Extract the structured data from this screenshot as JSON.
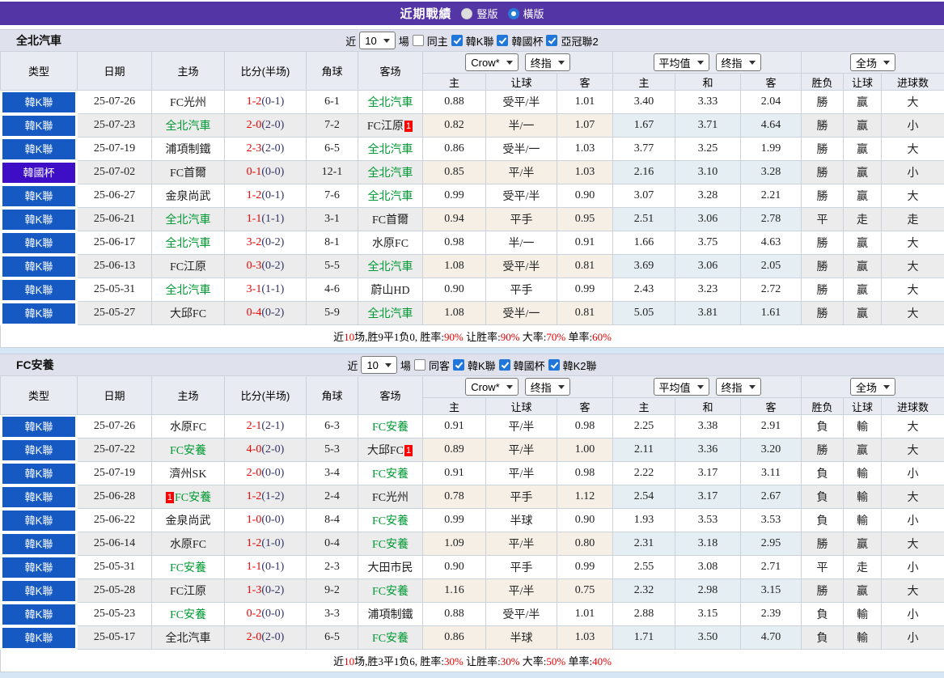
{
  "title_bar": {
    "title": "近期戰績",
    "radio_vertical": "豎版",
    "radio_horizontal": "橫版",
    "selected": "橫版"
  },
  "common": {
    "near_label": "近",
    "count_value": "10",
    "games_label": "場",
    "col_headers": [
      "类型",
      "日期",
      "主场",
      "比分(半场)",
      "角球",
      "客场"
    ],
    "sub_headers": [
      "主",
      "让球",
      "客",
      "主",
      "和",
      "客",
      "胜负",
      "让球",
      "进球数"
    ],
    "dropdowns": {
      "odds_company": "Crow*",
      "odds_stage": "终指",
      "avg_type": "平均值",
      "avg_stage": "终指",
      "scope": "全场"
    }
  },
  "colors": {
    "title_bar_bg": "#5435a6",
    "league_badge": {
      "k": "#1659c2",
      "cup": "#3e0ec6"
    },
    "green_team": "#009933",
    "score_red": "#ee0000",
    "half_score": "#333366",
    "result_red": "#e60000",
    "result_blue": "#2323d6",
    "result_green": "#009933",
    "odds_col_bg": "#fdf8f0",
    "avg_col_bg": "#ecf6fa",
    "checkbox_blue": "#2176d9"
  },
  "sections": [
    {
      "team": "全北汽車",
      "count": "10",
      "same_label": "同主",
      "same_checked": false,
      "leagues": [
        "韓K聯",
        "韓國杯",
        "亞冠聯2"
      ],
      "rows": [
        {
          "lg": "k",
          "league": "韓K聯",
          "date": "25-07-26",
          "home": {
            "name": "FC光州"
          },
          "score": "1-2",
          "half": "(0-1)",
          "corner": "6-1",
          "away": {
            "name": "全北汽車",
            "green": true
          },
          "odds": [
            "0.88",
            "受平/半",
            "1.01"
          ],
          "avg": [
            "3.40",
            "3.33",
            "2.04"
          ],
          "res": [
            [
              "勝",
              "r"
            ],
            [
              "赢",
              "r"
            ],
            [
              "大",
              "r"
            ]
          ]
        },
        {
          "lg": "k",
          "league": "韓K聯",
          "date": "25-07-23",
          "home": {
            "name": "全北汽車",
            "green": true
          },
          "score": "2-0",
          "half": "(2-0)",
          "corner": "7-2",
          "away": {
            "name": "FC江原",
            "card": "1",
            "card_pos": "after"
          },
          "odds": [
            "0.82",
            "半/一",
            "1.07"
          ],
          "avg": [
            "1.67",
            "3.71",
            "4.64"
          ],
          "res": [
            [
              "勝",
              "r"
            ],
            [
              "赢",
              "r"
            ],
            [
              "小",
              "b"
            ]
          ]
        },
        {
          "lg": "k",
          "league": "韓K聯",
          "date": "25-07-19",
          "home": {
            "name": "浦項制鐵"
          },
          "score": "2-3",
          "half": "(2-0)",
          "corner": "6-5",
          "away": {
            "name": "全北汽車",
            "green": true
          },
          "odds": [
            "0.86",
            "受半/一",
            "1.03"
          ],
          "avg": [
            "3.77",
            "3.25",
            "1.99"
          ],
          "res": [
            [
              "勝",
              "r"
            ],
            [
              "赢",
              "r"
            ],
            [
              "大",
              "r"
            ]
          ]
        },
        {
          "lg": "cup",
          "league": "韓國杯",
          "date": "25-07-02",
          "home": {
            "name": "FC首爾"
          },
          "score": "0-1",
          "half": "(0-0)",
          "corner": "12-1",
          "away": {
            "name": "全北汽車",
            "green": true
          },
          "odds": [
            "0.85",
            "平/半",
            "1.03"
          ],
          "avg": [
            "2.16",
            "3.10",
            "3.28"
          ],
          "res": [
            [
              "勝",
              "r"
            ],
            [
              "赢",
              "r"
            ],
            [
              "小",
              "b"
            ]
          ]
        },
        {
          "lg": "k",
          "league": "韓K聯",
          "date": "25-06-27",
          "home": {
            "name": "金泉尚武"
          },
          "score": "1-2",
          "half": "(0-1)",
          "corner": "7-6",
          "away": {
            "name": "全北汽車",
            "green": true
          },
          "odds": [
            "0.99",
            "受平/半",
            "0.90"
          ],
          "avg": [
            "3.07",
            "3.28",
            "2.21"
          ],
          "res": [
            [
              "勝",
              "r"
            ],
            [
              "赢",
              "r"
            ],
            [
              "大",
              "r"
            ]
          ]
        },
        {
          "lg": "k",
          "league": "韓K聯",
          "date": "25-06-21",
          "home": {
            "name": "全北汽車",
            "green": true
          },
          "score": "1-1",
          "half": "(1-1)",
          "corner": "3-1",
          "away": {
            "name": "FC首爾"
          },
          "odds": [
            "0.94",
            "平手",
            "0.95"
          ],
          "avg": [
            "2.51",
            "3.06",
            "2.78"
          ],
          "res": [
            [
              "平",
              "g"
            ],
            [
              "走",
              "g"
            ],
            [
              "走",
              "g"
            ]
          ]
        },
        {
          "lg": "k",
          "league": "韓K聯",
          "date": "25-06-17",
          "home": {
            "name": "全北汽車",
            "green": true
          },
          "score": "3-2",
          "half": "(0-2)",
          "corner": "8-1",
          "away": {
            "name": "水原FC"
          },
          "odds": [
            "0.98",
            "半/一",
            "0.91"
          ],
          "avg": [
            "1.66",
            "3.75",
            "4.63"
          ],
          "res": [
            [
              "勝",
              "r"
            ],
            [
              "赢",
              "r"
            ],
            [
              "大",
              "r"
            ]
          ]
        },
        {
          "lg": "k",
          "league": "韓K聯",
          "date": "25-06-13",
          "home": {
            "name": "FC江原"
          },
          "score": "0-3",
          "half": "(0-2)",
          "corner": "5-5",
          "away": {
            "name": "全北汽車",
            "green": true
          },
          "odds": [
            "1.08",
            "受平/半",
            "0.81"
          ],
          "avg": [
            "3.69",
            "3.06",
            "2.05"
          ],
          "res": [
            [
              "勝",
              "r"
            ],
            [
              "赢",
              "r"
            ],
            [
              "大",
              "r"
            ]
          ]
        },
        {
          "lg": "k",
          "league": "韓K聯",
          "date": "25-05-31",
          "home": {
            "name": "全北汽車",
            "green": true
          },
          "score": "3-1",
          "half": "(1-1)",
          "corner": "4-6",
          "away": {
            "name": "蔚山HD"
          },
          "odds": [
            "0.90",
            "平手",
            "0.99"
          ],
          "avg": [
            "2.43",
            "3.23",
            "2.72"
          ],
          "res": [
            [
              "勝",
              "r"
            ],
            [
              "赢",
              "r"
            ],
            [
              "大",
              "r"
            ]
          ]
        },
        {
          "lg": "k",
          "league": "韓K聯",
          "date": "25-05-27",
          "home": {
            "name": "大邱FC"
          },
          "score": "0-4",
          "half": "(0-2)",
          "corner": "5-9",
          "away": {
            "name": "全北汽車",
            "green": true
          },
          "odds": [
            "1.08",
            "受半/一",
            "0.81"
          ],
          "avg": [
            "5.05",
            "3.81",
            "1.61"
          ],
          "res": [
            [
              "勝",
              "r"
            ],
            [
              "赢",
              "r"
            ],
            [
              "大",
              "r"
            ]
          ]
        }
      ],
      "summary": [
        [
          "近",
          "k"
        ],
        [
          "10",
          "r"
        ],
        [
          "场,胜9平1负0, 胜率:",
          "k"
        ],
        [
          "90%",
          "r"
        ],
        [
          " 让胜率:",
          "k"
        ],
        [
          "90%",
          "r"
        ],
        [
          " 大率:",
          "k"
        ],
        [
          "70%",
          "r"
        ],
        [
          " 单率:",
          "k"
        ],
        [
          "60%",
          "r"
        ]
      ]
    },
    {
      "team": "FC安養",
      "count": "10",
      "same_label": "同客",
      "same_checked": false,
      "leagues": [
        "韓K聯",
        "韓國杯",
        "韓K2聯"
      ],
      "rows": [
        {
          "lg": "k",
          "league": "韓K聯",
          "date": "25-07-26",
          "home": {
            "name": "水原FC"
          },
          "score": "2-1",
          "half": "(2-1)",
          "corner": "6-3",
          "away": {
            "name": "FC安養",
            "green": true
          },
          "odds": [
            "0.91",
            "平/半",
            "0.98"
          ],
          "avg": [
            "2.25",
            "3.38",
            "2.91"
          ],
          "res": [
            [
              "負",
              "b"
            ],
            [
              "輸",
              "b"
            ],
            [
              "大",
              "r"
            ]
          ]
        },
        {
          "lg": "k",
          "league": "韓K聯",
          "date": "25-07-22",
          "home": {
            "name": "FC安養",
            "green": true
          },
          "score": "4-0",
          "half": "(2-0)",
          "corner": "5-3",
          "away": {
            "name": "大邱FC",
            "card": "1",
            "card_pos": "after"
          },
          "odds": [
            "0.89",
            "平/半",
            "1.00"
          ],
          "avg": [
            "2.11",
            "3.36",
            "3.20"
          ],
          "res": [
            [
              "勝",
              "r"
            ],
            [
              "赢",
              "r"
            ],
            [
              "大",
              "r"
            ]
          ]
        },
        {
          "lg": "k",
          "league": "韓K聯",
          "date": "25-07-19",
          "home": {
            "name": "濟州SK"
          },
          "score": "2-0",
          "half": "(0-0)",
          "corner": "3-4",
          "away": {
            "name": "FC安養",
            "green": true
          },
          "odds": [
            "0.91",
            "平/半",
            "0.98"
          ],
          "avg": [
            "2.22",
            "3.17",
            "3.11"
          ],
          "res": [
            [
              "負",
              "b"
            ],
            [
              "輸",
              "b"
            ],
            [
              "小",
              "b"
            ]
          ]
        },
        {
          "lg": "k",
          "league": "韓K聯",
          "date": "25-06-28",
          "home": {
            "name": "FC安養",
            "green": true,
            "card": "1",
            "card_pos": "before"
          },
          "score": "1-2",
          "half": "(1-2)",
          "corner": "2-4",
          "away": {
            "name": "FC光州"
          },
          "odds": [
            "0.78",
            "平手",
            "1.12"
          ],
          "avg": [
            "2.54",
            "3.17",
            "2.67"
          ],
          "res": [
            [
              "負",
              "b"
            ],
            [
              "輸",
              "b"
            ],
            [
              "大",
              "r"
            ]
          ]
        },
        {
          "lg": "k",
          "league": "韓K聯",
          "date": "25-06-22",
          "home": {
            "name": "金泉尚武"
          },
          "score": "1-0",
          "half": "(0-0)",
          "corner": "8-4",
          "away": {
            "name": "FC安養",
            "green": true
          },
          "odds": [
            "0.99",
            "半球",
            "0.90"
          ],
          "avg": [
            "1.93",
            "3.53",
            "3.53"
          ],
          "res": [
            [
              "負",
              "b"
            ],
            [
              "輸",
              "b"
            ],
            [
              "小",
              "b"
            ]
          ]
        },
        {
          "lg": "k",
          "league": "韓K聯",
          "date": "25-06-14",
          "home": {
            "name": "水原FC"
          },
          "score": "1-2",
          "half": "(1-0)",
          "corner": "0-4",
          "away": {
            "name": "FC安養",
            "green": true
          },
          "odds": [
            "1.09",
            "平/半",
            "0.80"
          ],
          "avg": [
            "2.31",
            "3.18",
            "2.95"
          ],
          "res": [
            [
              "勝",
              "r"
            ],
            [
              "赢",
              "r"
            ],
            [
              "大",
              "r"
            ]
          ]
        },
        {
          "lg": "k",
          "league": "韓K聯",
          "date": "25-05-31",
          "home": {
            "name": "FC安養",
            "green": true
          },
          "score": "1-1",
          "half": "(0-1)",
          "corner": "2-3",
          "away": {
            "name": "大田市民"
          },
          "odds": [
            "0.90",
            "平手",
            "0.99"
          ],
          "avg": [
            "2.55",
            "3.08",
            "2.71"
          ],
          "res": [
            [
              "平",
              "g"
            ],
            [
              "走",
              "g"
            ],
            [
              "小",
              "b"
            ]
          ]
        },
        {
          "lg": "k",
          "league": "韓K聯",
          "date": "25-05-28",
          "home": {
            "name": "FC江原"
          },
          "score": "1-3",
          "half": "(0-2)",
          "corner": "9-2",
          "away": {
            "name": "FC安養",
            "green": true
          },
          "odds": [
            "1.16",
            "平/半",
            "0.75"
          ],
          "avg": [
            "2.32",
            "2.98",
            "3.15"
          ],
          "res": [
            [
              "勝",
              "r"
            ],
            [
              "赢",
              "r"
            ],
            [
              "大",
              "r"
            ]
          ]
        },
        {
          "lg": "k",
          "league": "韓K聯",
          "date": "25-05-23",
          "home": {
            "name": "FC安養",
            "green": true
          },
          "score": "0-2",
          "half": "(0-0)",
          "corner": "3-3",
          "away": {
            "name": "浦項制鐵"
          },
          "odds": [
            "0.88",
            "受平/半",
            "1.01"
          ],
          "avg": [
            "2.88",
            "3.15",
            "2.39"
          ],
          "res": [
            [
              "負",
              "b"
            ],
            [
              "輸",
              "b"
            ],
            [
              "小",
              "b"
            ]
          ]
        },
        {
          "lg": "k",
          "league": "韓K聯",
          "date": "25-05-17",
          "home": {
            "name": "全北汽車"
          },
          "score": "2-0",
          "half": "(2-0)",
          "corner": "6-5",
          "away": {
            "name": "FC安養",
            "green": true
          },
          "odds": [
            "0.86",
            "半球",
            "1.03"
          ],
          "avg": [
            "1.71",
            "3.50",
            "4.70"
          ],
          "res": [
            [
              "負",
              "b"
            ],
            [
              "輸",
              "b"
            ],
            [
              "小",
              "b"
            ]
          ]
        }
      ],
      "summary": [
        [
          "近",
          "k"
        ],
        [
          "10",
          "r"
        ],
        [
          "场,胜3平1负6, 胜率:",
          "k"
        ],
        [
          "30%",
          "r"
        ],
        [
          " 让胜率:",
          "k"
        ],
        [
          "30%",
          "r"
        ],
        [
          " 大率:",
          "k"
        ],
        [
          "50%",
          "r"
        ],
        [
          " 单率:",
          "k"
        ],
        [
          "40%",
          "r"
        ]
      ]
    }
  ]
}
